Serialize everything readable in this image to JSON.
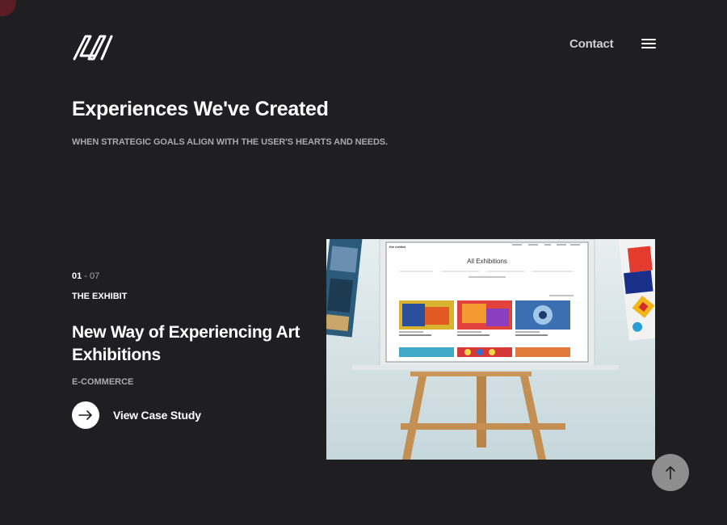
{
  "header": {
    "logo_icon": "av-monogram-logo",
    "contact_label": "Contact",
    "menu_icon": "hamburger-icon"
  },
  "hero": {
    "title": "Experiences We've Created",
    "subtitle": "WHEN STRATEGIC GOALS ALIGN WITH THE USER'S HEARTS AND NEEDS."
  },
  "project": {
    "index": "01",
    "separator": " - ",
    "total": "07",
    "name": "THE EXHIBIT",
    "headline": "New Way of Experiencing Art Exhibitions",
    "category": "E-COMMERCE",
    "cta_label": "View Case Study",
    "cta_icon": "arrow-right-icon",
    "image": {
      "brand": "the exhibit",
      "page_title": "All Exhibitions"
    }
  },
  "scroll_top": {
    "icon": "arrow-up-icon"
  },
  "colors": {
    "background": "#1f1f21",
    "text_primary": "#ffffff",
    "text_muted": "#a8a8a8",
    "scroll_button": "#8e8e8e"
  }
}
